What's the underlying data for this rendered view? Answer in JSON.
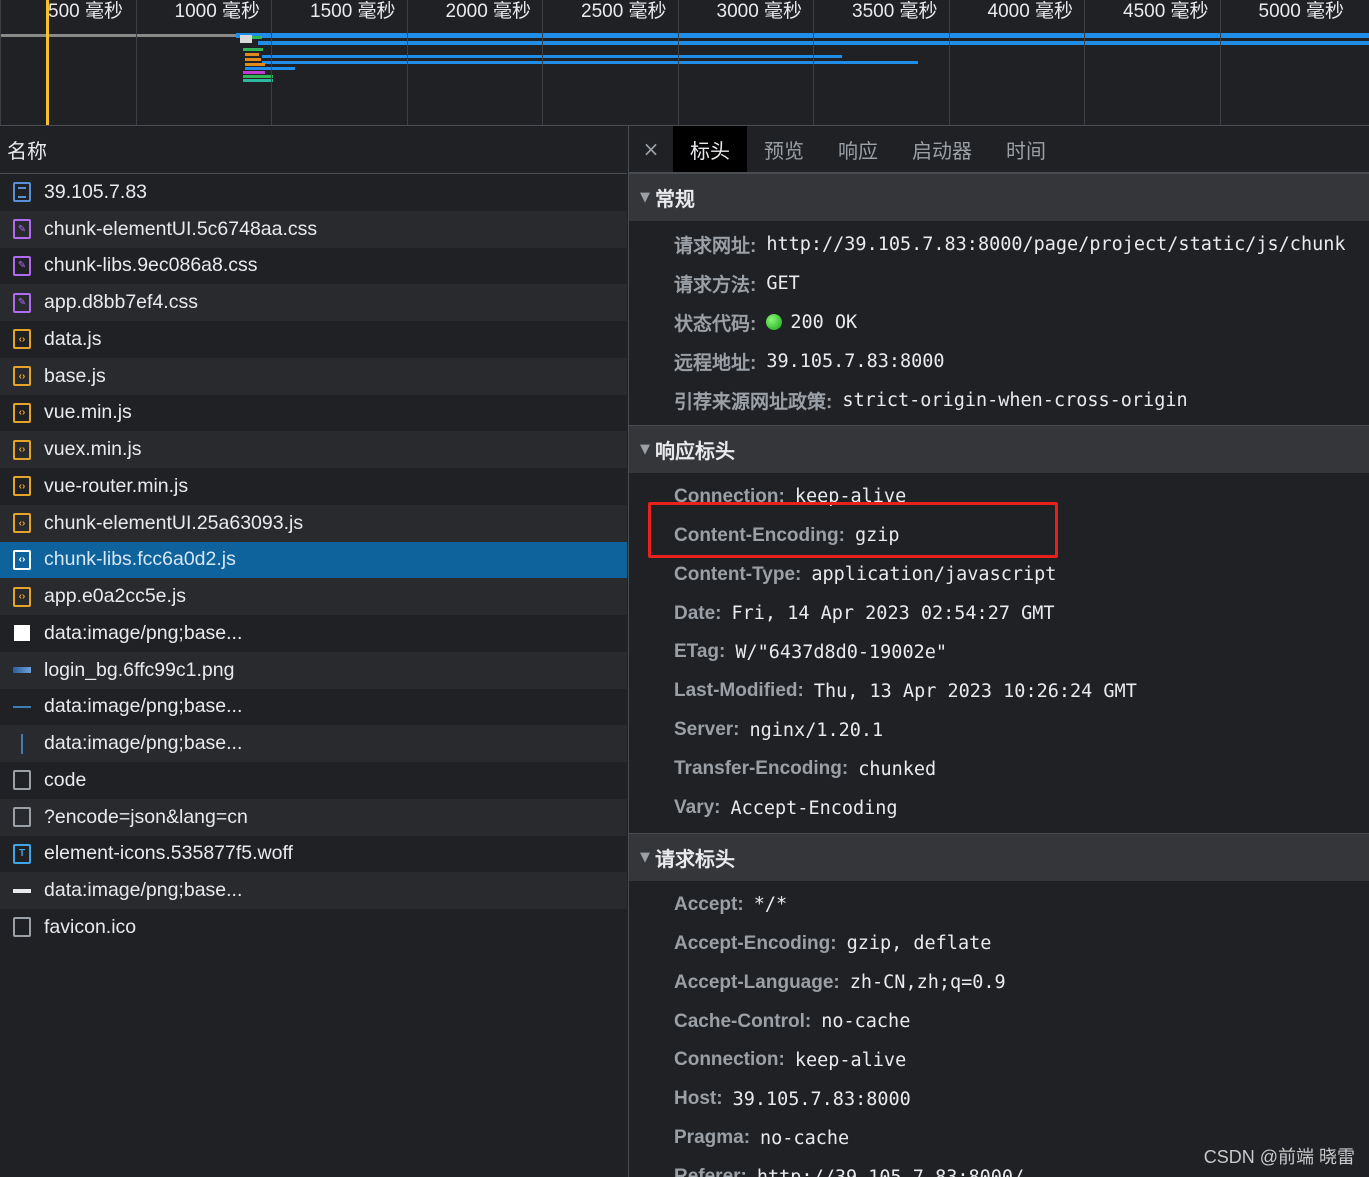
{
  "timeline": {
    "ticks": [
      "500 毫秒",
      "1000 毫秒",
      "1500 毫秒",
      "2000 毫秒",
      "2500 毫秒",
      "3000 毫秒",
      "3500 毫秒",
      "4000 毫秒",
      "4500 毫秒",
      "5000 毫秒"
    ]
  },
  "list": {
    "header": "名称",
    "items": [
      {
        "name": "39.105.7.83",
        "icon": "document-icon"
      },
      {
        "name": "chunk-elementUI.5c6748aa.css",
        "icon": "stylesheet-icon"
      },
      {
        "name": "chunk-libs.9ec086a8.css",
        "icon": "stylesheet-icon"
      },
      {
        "name": "app.d8bb7ef4.css",
        "icon": "stylesheet-icon"
      },
      {
        "name": "data.js",
        "icon": "script-icon"
      },
      {
        "name": "base.js",
        "icon": "script-icon"
      },
      {
        "name": "vue.min.js",
        "icon": "script-icon"
      },
      {
        "name": "vuex.min.js",
        "icon": "script-icon"
      },
      {
        "name": "vue-router.min.js",
        "icon": "script-icon"
      },
      {
        "name": "chunk-elementUI.25a63093.js",
        "icon": "script-icon"
      },
      {
        "name": "chunk-libs.fcc6a0d2.js",
        "icon": "script-icon",
        "selected": true
      },
      {
        "name": "app.e0a2cc5e.js",
        "icon": "script-icon"
      },
      {
        "name": "data:image/png;base...",
        "icon": "white-image-icon"
      },
      {
        "name": "login_bg.6ffc99c1.png",
        "icon": "image-icon"
      },
      {
        "name": "data:image/png;base...",
        "icon": "horizontal-line-icon"
      },
      {
        "name": "data:image/png;base...",
        "icon": "vertical-line-icon"
      },
      {
        "name": "code",
        "icon": "blank-file-icon"
      },
      {
        "name": "?encode=json&lang=cn",
        "icon": "blank-file-icon"
      },
      {
        "name": "element-icons.535877f5.woff",
        "icon": "font-icon"
      },
      {
        "name": "data:image/png;base...",
        "icon": "dash-image-icon"
      },
      {
        "name": "favicon.ico",
        "icon": "blank-file-icon"
      }
    ]
  },
  "details": {
    "close": "×",
    "tabs": [
      "标头",
      "预览",
      "响应",
      "启动器",
      "时间"
    ],
    "active_tab": "标头",
    "general": {
      "title": "常规",
      "rows": [
        {
          "k": "请求网址:",
          "v": "http://39.105.7.83:8000/page/project/static/js/chunk"
        },
        {
          "k": "请求方法:",
          "v": "GET"
        },
        {
          "k": "状态代码:",
          "v": "200 OK",
          "status": true
        },
        {
          "k": "远程地址:",
          "v": "39.105.7.83:8000"
        },
        {
          "k": "引荐来源网址政策:",
          "v": "strict-origin-when-cross-origin"
        }
      ]
    },
    "response_headers": {
      "title": "响应标头",
      "rows": [
        {
          "k": "Connection:",
          "v": "keep-alive"
        },
        {
          "k": "Content-Encoding:",
          "v": "gzip"
        },
        {
          "k": "Content-Type:",
          "v": "application/javascript"
        },
        {
          "k": "Date:",
          "v": "Fri, 14 Apr 2023 02:54:27 GMT"
        },
        {
          "k": "ETag:",
          "v": "W/\"6437d8d0-19002e\""
        },
        {
          "k": "Last-Modified:",
          "v": "Thu, 13 Apr 2023 10:26:24 GMT"
        },
        {
          "k": "Server:",
          "v": "nginx/1.20.1"
        },
        {
          "k": "Transfer-Encoding:",
          "v": "chunked"
        },
        {
          "k": "Vary:",
          "v": "Accept-Encoding"
        }
      ]
    },
    "request_headers": {
      "title": "请求标头",
      "rows": [
        {
          "k": "Accept:",
          "v": "*/*"
        },
        {
          "k": "Accept-Encoding:",
          "v": "gzip, deflate"
        },
        {
          "k": "Accept-Language:",
          "v": "zh-CN,zh;q=0.9"
        },
        {
          "k": "Cache-Control:",
          "v": "no-cache"
        },
        {
          "k": "Connection:",
          "v": "keep-alive"
        },
        {
          "k": "Host:",
          "v": "39.105.7.83:8000"
        },
        {
          "k": "Pragma:",
          "v": "no-cache"
        },
        {
          "k": "Referer:",
          "v": "http://39.105.7.83:8000/"
        }
      ]
    }
  },
  "watermark": "CSDN @前端 晓雷",
  "colors": {
    "accent_blue": "#1f8ee8",
    "selected_row": "#0e639c",
    "highlight_box": "#e8211d",
    "cursor": "#f9c02a"
  }
}
